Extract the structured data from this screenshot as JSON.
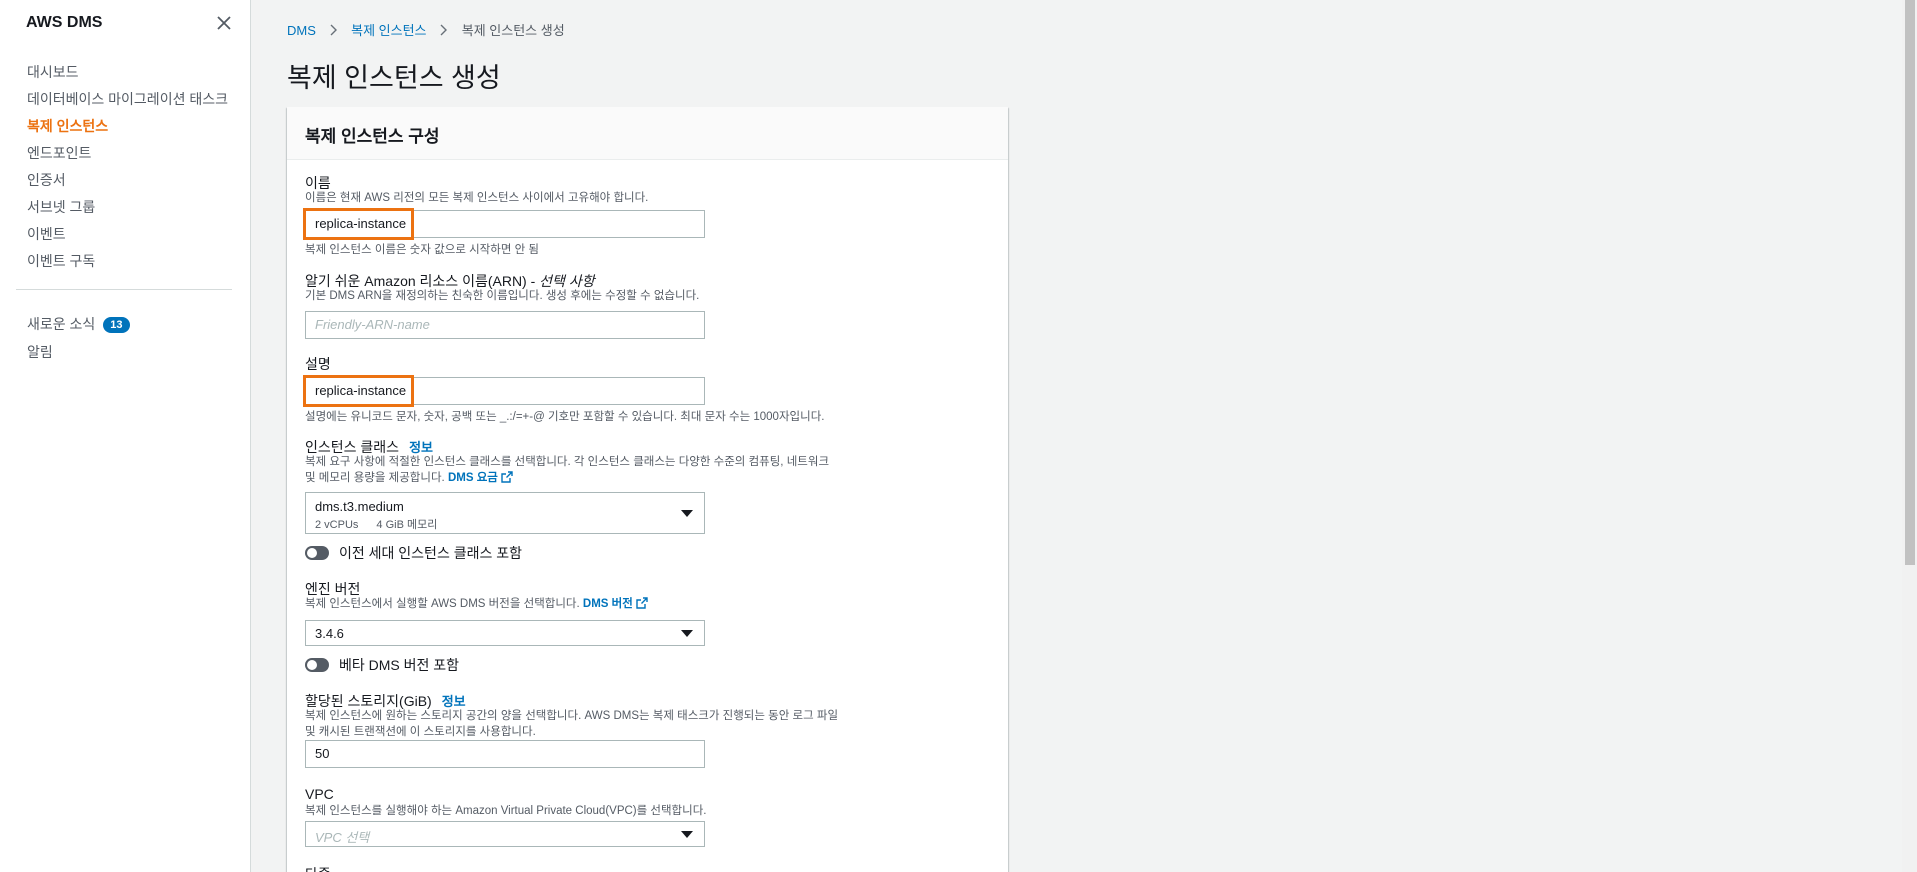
{
  "sidebar": {
    "title": "AWS DMS",
    "items": [
      {
        "label": "대시보드"
      },
      {
        "label": "데이터베이스 마이그레이션 태스크"
      },
      {
        "label": "복제 인스턴스"
      },
      {
        "label": "엔드포인트"
      },
      {
        "label": "인증서"
      },
      {
        "label": "서브넷 그룹"
      },
      {
        "label": "이벤트"
      },
      {
        "label": "이벤트 구독"
      }
    ],
    "news": {
      "label": "새로운 소식",
      "count": "13"
    },
    "alerts": {
      "label": "알림"
    }
  },
  "breadcrumb": {
    "items": [
      "DMS",
      "복제 인스턴스",
      "복제 인스턴스 생성"
    ]
  },
  "page": {
    "title": "복제 인스턴스 생성"
  },
  "panel": {
    "title": "복제 인스턴스 구성",
    "name": {
      "label": "이름",
      "desc": "이름은 현재 AWS 리전의 모든 복제 인스턴스 사이에서 고유해야 합니다.",
      "value": "replica-instance",
      "hint": "복제 인스턴스 이름은 숫자 값으로 시작하면 안 됨"
    },
    "arn": {
      "label": "알기 쉬운 Amazon 리소스 이름(ARN) - ",
      "label_optional": "선택 사항",
      "desc": "기본 DMS ARN을 재정의하는 친숙한 이름입니다. 생성 후에는 수정할 수 없습니다.",
      "placeholder": "Friendly-ARN-name"
    },
    "description": {
      "label": "설명",
      "value": "replica-instance",
      "hint": "설명에는 유니코드 문자, 숫자, 공백 또는 _.:/=+-@ 기호만 포함할 수 있습니다. 최대 문자 수는 1000자입니다."
    },
    "instance_class": {
      "label": "인스턴스 클래스",
      "info": "정보",
      "desc_line1": "복제 요구 사항에 적절한 인스턴스 클래스를 선택합니다. 각 인스턴스 클래스는 다양한 수준의 컴퓨팅, 네트워크",
      "desc_line2": "및 메모리 용량을 제공합니다.",
      "desc_link": "DMS 요금",
      "value": "dms.t3.medium",
      "vcpus": "2 vCPUs",
      "memory": "4 GiB 메모리",
      "toggle_label": "이전 세대 인스턴스 클래스 포함"
    },
    "engine": {
      "label": "엔진 버전",
      "desc": "복제 인스턴스에서 실행할 AWS DMS 버전을 선택합니다.",
      "desc_link": "DMS 버전",
      "value": "3.4.6",
      "toggle_label": "베타 DMS 버전 포함"
    },
    "storage": {
      "label": "할당된 스토리지(GiB)",
      "info": "정보",
      "desc_line1": "복제 인스턴스에 원하는 스토리지 공간의 양을 선택합니다. AWS DMS는 복제 태스크가 진행되는 동안 로그 파일",
      "desc_line2": "및 캐시된 트랜잭션에 이 스토리지를 사용합니다.",
      "value": "50"
    },
    "vpc": {
      "label": "VPC",
      "desc": "복제 인스턴스를 실행해야 하는 Amazon Virtual Private Cloud(VPC)를 선택합니다.",
      "placeholder": "VPC 선택"
    },
    "next_label": "다중"
  },
  "colors": {
    "accent": "#ec7211",
    "link": "#0073bb",
    "badge": "#0073bb"
  }
}
